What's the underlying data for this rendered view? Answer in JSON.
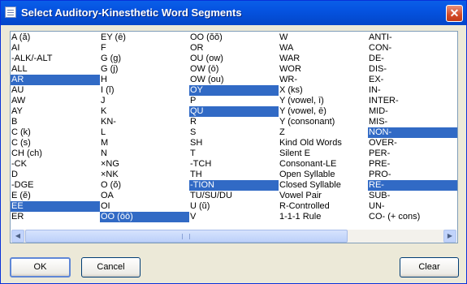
{
  "window": {
    "title": "Select Auditory-Kinesthetic Word Segments",
    "close_glyph": "✕"
  },
  "list": {
    "columns": [
      [
        "A (ă)",
        "AI",
        "-ALK/-ALT",
        "ALL",
        "AR",
        "AU",
        "AW",
        "AY",
        "B",
        "C (k)",
        "C (s)",
        "CH (ch)",
        "-CK",
        "D",
        "-DGE",
        "E (ĕ)",
        "EE",
        "ER"
      ],
      [
        "EY (ē)",
        "F",
        "G (g)",
        "G (j)",
        "H",
        "I (ĭ)",
        "J",
        "K",
        "KN-",
        "L",
        "M",
        "N",
        "×NG",
        "×NK",
        "O (ŏ)",
        "OA",
        "OI",
        "OO (ōō)"
      ],
      [
        "OO (ŏŏ)",
        "OR",
        "OU (ow)",
        "OW (ō)",
        "OW (ou)",
        "OY",
        "P",
        "QU",
        "R",
        "S",
        "SH",
        "T",
        "-TCH",
        "TH",
        "-TION",
        "TU/SU/DU",
        "U (ŭ)",
        "V"
      ],
      [
        "W",
        "WA",
        "WAR",
        "WOR",
        "WR-",
        "X (ks)",
        "Y (vowel, ī)",
        "Y (vowel, ē)",
        "Y (consonant)",
        "Z",
        "Kind Old Words",
        "Silent E",
        "Consonant-LE",
        "Open Syllable",
        "Closed Syllable",
        "Vowel Pair",
        "R-Controlled",
        "1-1-1 Rule"
      ],
      [
        "ANTI-",
        "CON-",
        "DE-",
        "DIS-",
        "EX-",
        "IN-",
        "INTER-",
        "MID-",
        "MIS-",
        "NON-",
        "OVER-",
        "PER-",
        "PRE-",
        "PRO-",
        "RE-",
        "SUB-",
        "UN-",
        "CO- (+ cons)"
      ]
    ],
    "selected": [
      "AR",
      "EE",
      "OO (ōō)",
      "OY",
      "QU",
      "-TION",
      "NON-",
      "RE-"
    ]
  },
  "scrollbar": {
    "left_arrow": "◀",
    "right_arrow": "▶",
    "thumb_fraction": 0.77
  },
  "buttons": {
    "ok": "OK",
    "cancel": "Cancel",
    "clear": "Clear"
  },
  "colors": {
    "selection": "#316ac5",
    "titlebar": "#0553e0"
  }
}
